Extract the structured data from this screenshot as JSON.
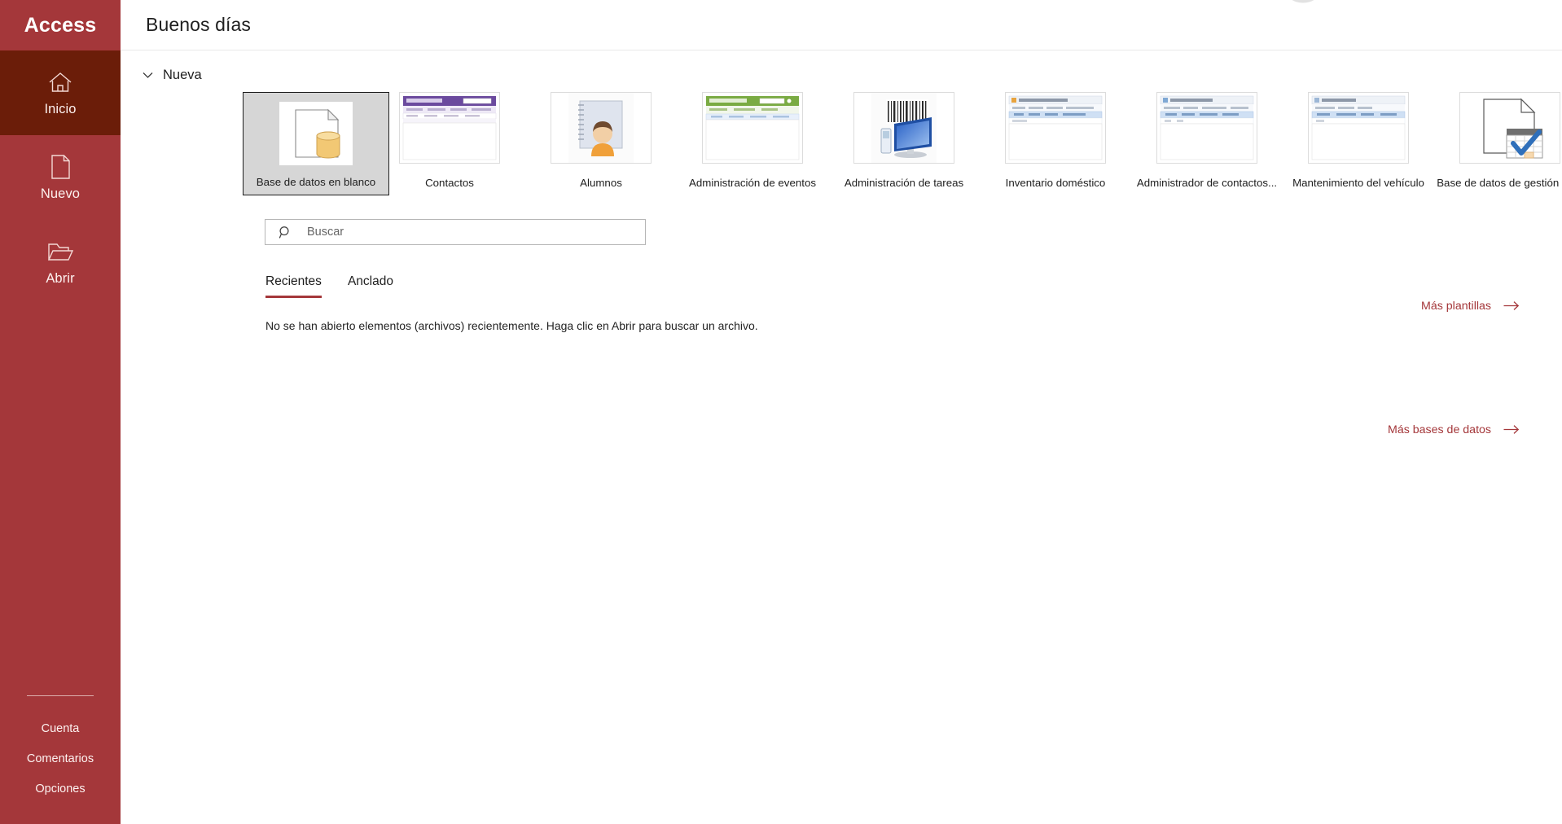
{
  "sidebar": {
    "brand": "Access",
    "nav": [
      {
        "label": "Inicio",
        "icon": "home-icon",
        "active": true
      },
      {
        "label": "Nuevo",
        "icon": "document-icon",
        "active": false
      },
      {
        "label": "Abrir",
        "icon": "folder-icon",
        "active": false
      }
    ],
    "bottom_links": [
      {
        "label": "Cuenta"
      },
      {
        "label": "Comentarios"
      },
      {
        "label": "Opciones"
      }
    ]
  },
  "header": {
    "greeting": "Buenos días"
  },
  "new_section": {
    "title": "Nueva",
    "chevron": "chevron-down-icon",
    "templates": [
      {
        "name": "Base de datos en blanco",
        "thumb": "blank-database-thumb",
        "selected": true
      },
      {
        "name": "Contactos",
        "thumb": "contacts-thumb",
        "selected": false
      },
      {
        "name": "Alumnos",
        "thumb": "students-thumb",
        "selected": false
      },
      {
        "name": "Administración de eventos",
        "thumb": "events-thumb",
        "selected": false
      },
      {
        "name": "Administración de tareas",
        "thumb": "tasks-thumb",
        "selected": false
      },
      {
        "name": "Inventario doméstico",
        "thumb": "home-inventory-thumb",
        "selected": false
      },
      {
        "name": "Administrador de contactos...",
        "thumb": "contact-manager-thumb",
        "selected": false
      },
      {
        "name": "Mantenimiento del vehículo",
        "thumb": "vehicle-thumb",
        "selected": false
      },
      {
        "name": "Base de datos de gestión de...",
        "thumb": "management-db-thumb",
        "selected": false
      }
    ],
    "more_templates": "Más plantillas"
  },
  "search": {
    "placeholder": "Buscar",
    "value": "",
    "icon": "search-icon"
  },
  "recent": {
    "tabs": [
      {
        "label": "Recientes",
        "active": true
      },
      {
        "label": "Anclado",
        "active": false
      }
    ],
    "empty_message": "No se han abierto elementos (archivos) recientemente. Haga clic en Abrir para buscar un archivo.",
    "more_databases": "Más bases de datos"
  },
  "colors": {
    "brand": "#a4373a",
    "brand_active": "#6b1d09",
    "link": "#a4373a",
    "text": "#1f1f1f"
  }
}
